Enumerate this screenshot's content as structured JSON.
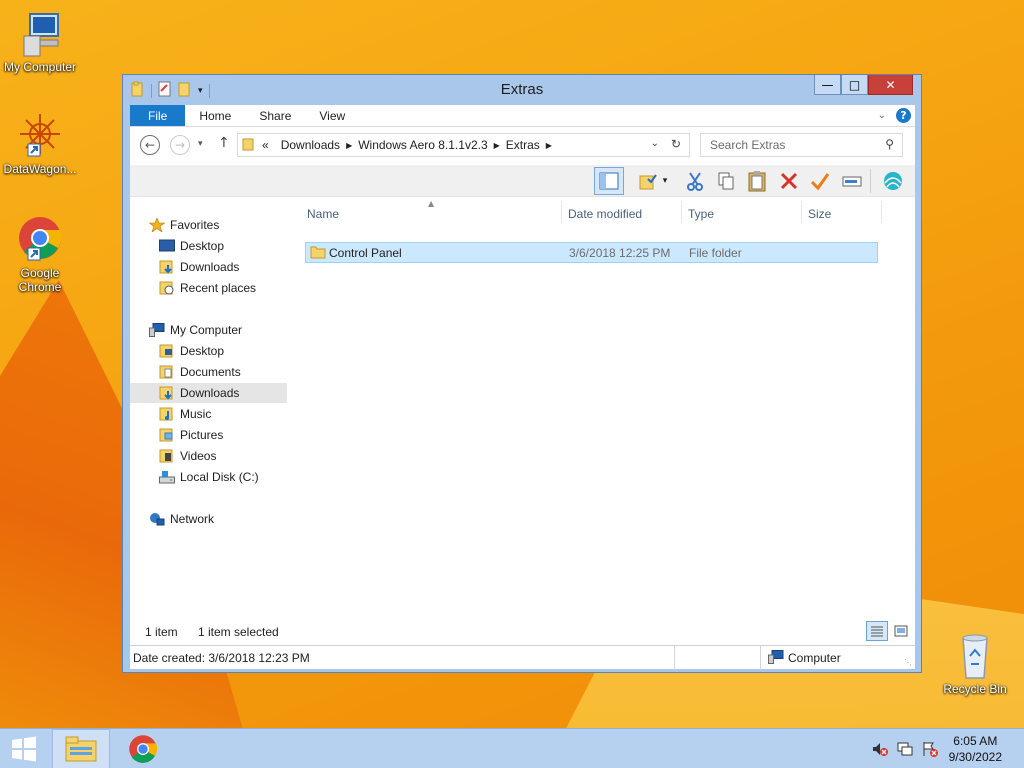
{
  "desktop": {
    "icons": [
      {
        "label": "My Computer"
      },
      {
        "label": "DataWagon..."
      },
      {
        "label": "Google Chrome"
      },
      {
        "label": "Recycle Bin"
      }
    ]
  },
  "window": {
    "title": "Extras",
    "ribbon_tabs": [
      "File",
      "Home",
      "Share",
      "View"
    ],
    "address": {
      "overflow": "«",
      "crumbs": [
        "Downloads",
        "Windows Aero 8.1.1v2.3",
        "Extras"
      ]
    },
    "search_placeholder": "Search Extras",
    "nav": {
      "favorites": "Favorites",
      "fav_items": [
        "Desktop",
        "Downloads",
        "Recent places"
      ],
      "computer": "My Computer",
      "computer_items": [
        "Desktop",
        "Documents",
        "Downloads",
        "Music",
        "Pictures",
        "Videos",
        "Local Disk (C:)"
      ],
      "network": "Network"
    },
    "columns": [
      "Name",
      "Date modified",
      "Type",
      "Size"
    ],
    "files": [
      {
        "name": "Control Panel",
        "date": "3/6/2018 12:25 PM",
        "type": "File folder",
        "size": ""
      }
    ],
    "status": {
      "count": "1 item",
      "selected": "1 item selected"
    },
    "details": {
      "created": "Date created: 3/6/2018 12:23 PM",
      "location": "Computer"
    }
  },
  "taskbar": {
    "time": "6:05 AM",
    "date": "9/30/2022"
  }
}
